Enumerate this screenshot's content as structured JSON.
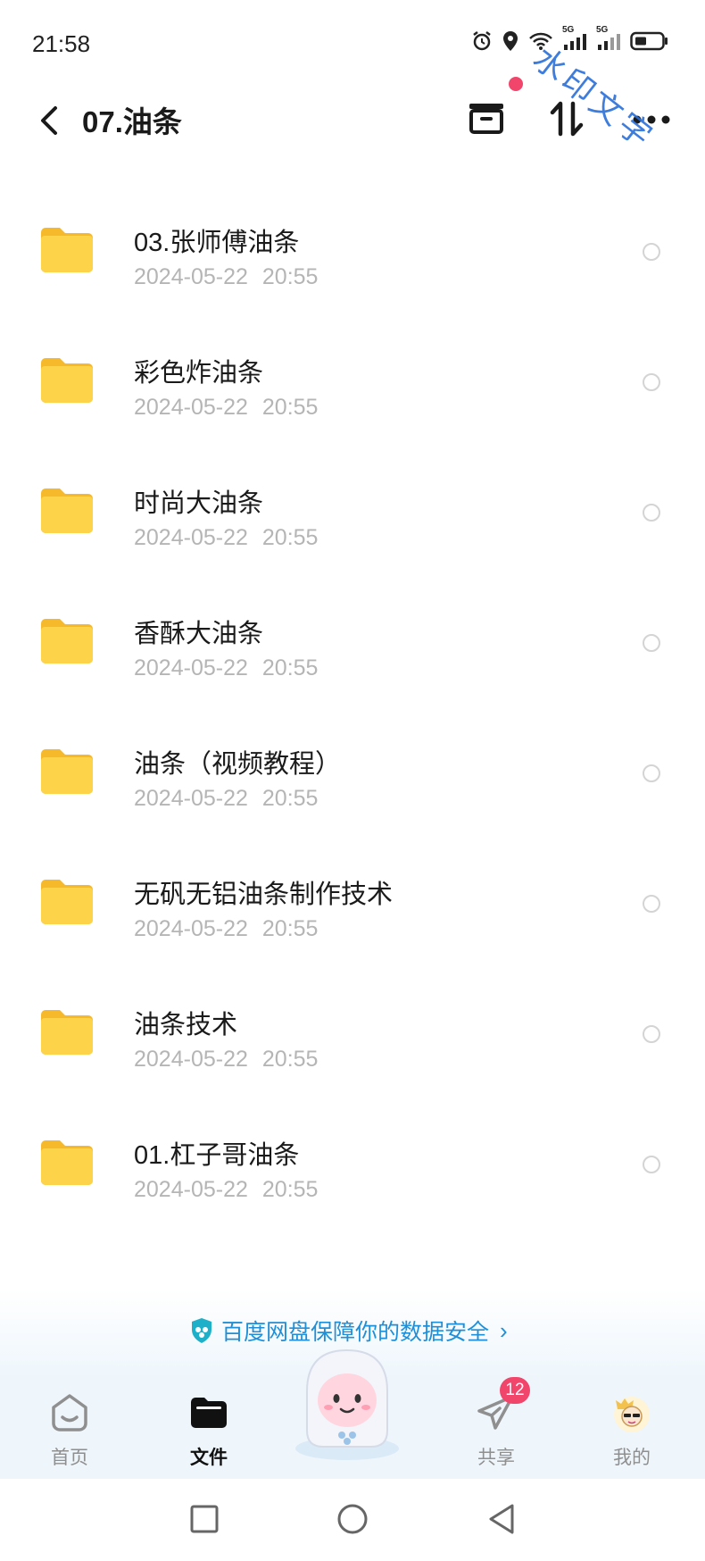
{
  "status_bar": {
    "time": "21:58",
    "icons": [
      "alarm-icon",
      "location-icon",
      "wifi-icon",
      "signal-5g-icon",
      "signal-5g-icon",
      "battery-icon"
    ],
    "network_label_1": "5G",
    "network_label_2": "5G"
  },
  "header": {
    "title": "07.油条",
    "watermark": "水印文字"
  },
  "folders": [
    {
      "name": "03.张师傅油条",
      "date": "2024-05-22",
      "time": "20:55"
    },
    {
      "name": "彩色炸油条",
      "date": "2024-05-22",
      "time": "20:55"
    },
    {
      "name": "时尚大油条",
      "date": "2024-05-22",
      "time": "20:55"
    },
    {
      "name": "香酥大油条",
      "date": "2024-05-22",
      "time": "20:55"
    },
    {
      "name": "油条（视频教程）",
      "date": "2024-05-22",
      "time": "20:55"
    },
    {
      "name": "无矾无铝油条制作技术",
      "date": "2024-05-22",
      "time": "20:55"
    },
    {
      "name": "油条技术",
      "date": "2024-05-22",
      "time": "20:55"
    },
    {
      "name": "01.杠子哥油条",
      "date": "2024-05-22",
      "time": "20:55"
    }
  ],
  "security_banner": {
    "text": "百度网盘保障你的数据安全",
    "chevron": "›"
  },
  "bottom_nav": {
    "home": "首页",
    "files": "文件",
    "share": "共享",
    "share_badge": "12",
    "mine": "我的",
    "active": "files"
  },
  "colors": {
    "accent": "#1f8fd8",
    "badge": "#f2456b",
    "folder": "#f9c83a",
    "date_text": "#b5b5b5"
  }
}
